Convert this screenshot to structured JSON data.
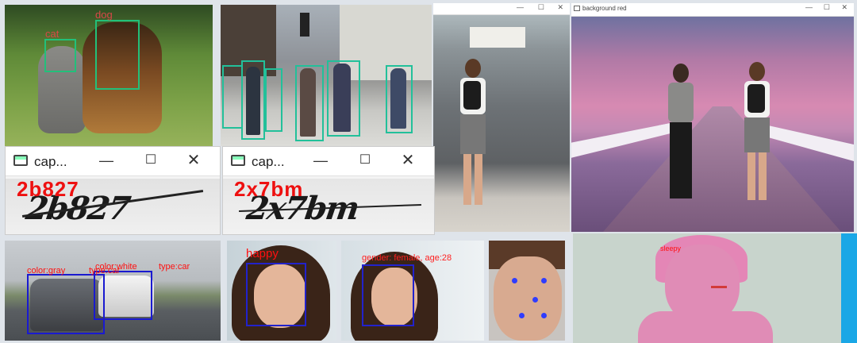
{
  "detections": {
    "pets": {
      "labels": [
        "cat",
        "dog"
      ],
      "box_color": "#22c07a",
      "text_color": "#d94848"
    },
    "cars": {
      "labels": [
        "color:gray",
        "type:car",
        "color:white",
        "type:car"
      ],
      "box_color": "#1a1ad0",
      "text_color": "#ff1010"
    },
    "face_emotion": {
      "label": "happy",
      "text_color": "#ff1010",
      "box_color": "#2222cc"
    },
    "face_attr": {
      "label": "gender: female, age:28",
      "text_color": "#ff2020",
      "box_color": "#2222cc"
    },
    "sleepy": {
      "label": "sleepy",
      "text_color": "#ff1010"
    }
  },
  "captcha_windows": [
    {
      "title": "cap...",
      "predicted": "2b827",
      "image_text": "2b827",
      "buttons": {
        "minimize": "—",
        "maximize": "☐",
        "close": "✕"
      }
    },
    {
      "title": "cap...",
      "predicted": "2x7bm",
      "image_text": "2x7bm",
      "buttons": {
        "minimize": "—",
        "maximize": "☐",
        "close": "✕"
      }
    }
  ],
  "background_window": {
    "title": "background red",
    "buttons": {
      "minimize": "—",
      "maximize": "☐",
      "close": "✕"
    }
  },
  "walk_window": {
    "buttons": {
      "minimize": "—",
      "maximize": "☐",
      "close": "✕"
    }
  },
  "colors": {
    "taskbar_accent": "#1aa7e6"
  }
}
